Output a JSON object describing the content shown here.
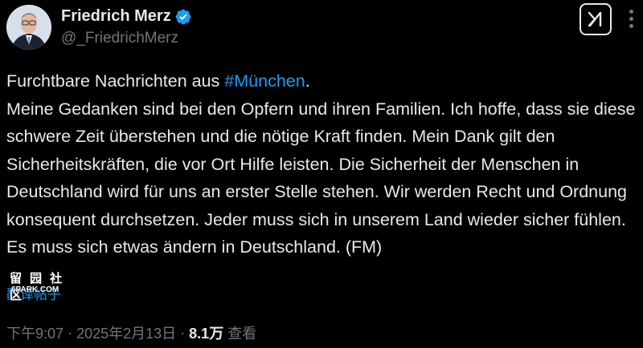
{
  "author": {
    "display_name": "Friedrich Merz",
    "handle": "@_FriedrichMerz",
    "verified": true
  },
  "header": {
    "grok_icon": "grok-icon",
    "more_icon": "more-vertical-icon"
  },
  "tweet": {
    "line1_text": "Furchtbare Nachrichten aus ",
    "hashtag": "#München",
    "line1_suffix": ".",
    "body": "Meine Gedanken sind bei den Opfern und ihren Familien. Ich hoffe, dass sie diese schwere Zeit überstehen und die nötige Kraft finden. Mein Dank gilt den Sicherheitskräften, die vor Ort Hilfe leisten. Die Sicherheit der Menschen in Deutschland wird für uns an erster Stelle stehen. Wir werden Recht und Ordnung konsequent durchsetzen. Jeder muss sich in unserem Land wieder sicher fühlen. Es muss sich etwas ändern in Deutschland. (FM)"
  },
  "translate_label": "翻译帖子",
  "watermark": {
    "main": "留园社区",
    "sub": "6PARK.COM"
  },
  "meta": {
    "time": "下午9:07",
    "sep": "·",
    "date": "2025年2月13日",
    "sep2": "·",
    "views_count": "8.1万",
    "views_label": "查看"
  },
  "colors": {
    "background": "#000000",
    "text": "#e7e9ea",
    "secondary": "#71767b",
    "link": "#1d9bf0",
    "verified": "#1d9bf0"
  }
}
